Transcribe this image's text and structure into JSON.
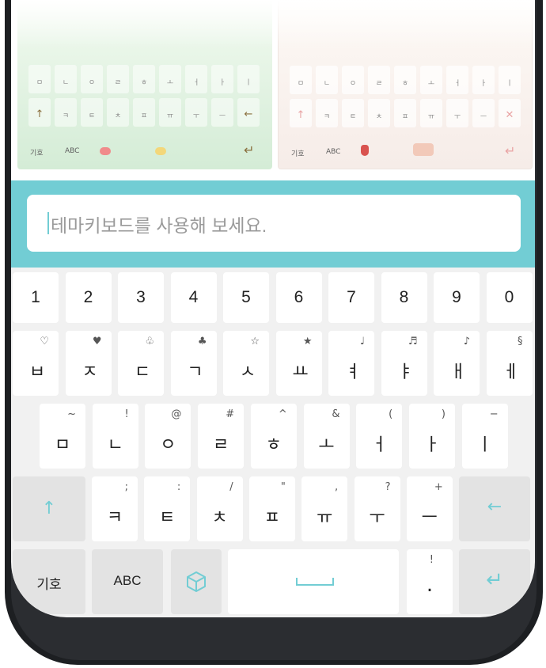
{
  "themes": [
    {
      "name": "mint",
      "rows": [
        [
          "ㅁ",
          "ㄴ",
          "ㅇ",
          "ㄹ",
          "ㅎ",
          "ㅗ",
          "ㅓ",
          "ㅏ",
          "ㅣ"
        ],
        [
          "↑",
          "ㅋ",
          "ㅌ",
          "ㅊ",
          "ㅍ",
          "ㅠ",
          "ㅜ",
          "ㅡ",
          "←"
        ]
      ],
      "bottom": {
        "symbols": "기호",
        "abc": "ABC",
        "enter": "↵"
      },
      "colors": {
        "accent": "#8a6f3e",
        "macaron1": "#f08b8b",
        "macaron2": "#f3d77a"
      }
    },
    {
      "name": "pink",
      "rows": [
        [
          "ㅁ",
          "ㄴ",
          "ㅇ",
          "ㄹ",
          "ㅎ",
          "ㅗ",
          "ㅓ",
          "ㅏ",
          "ㅣ"
        ],
        [
          "↑",
          "ㅋ",
          "ㅌ",
          "ㅊ",
          "ㅍ",
          "ㅠ",
          "ㅜ",
          "ㅡ",
          "✕"
        ]
      ],
      "bottom": {
        "symbols": "기호",
        "abc": "ABC",
        "enter": "↵"
      },
      "colors": {
        "accent": "#e9a3a3"
      }
    }
  ],
  "input": {
    "placeholder": "테마키보드를 사용해 보세요."
  },
  "keyboard": {
    "number_row": [
      "1",
      "2",
      "3",
      "4",
      "5",
      "6",
      "7",
      "8",
      "9",
      "0"
    ],
    "row1": [
      {
        "main": "ㅂ",
        "sub": "♡"
      },
      {
        "main": "ㅈ",
        "sub": "♥"
      },
      {
        "main": "ㄷ",
        "sub": "♧"
      },
      {
        "main": "ㄱ",
        "sub": "♣"
      },
      {
        "main": "ㅅ",
        "sub": "☆"
      },
      {
        "main": "ㅛ",
        "sub": "★"
      },
      {
        "main": "ㅕ",
        "sub": "♩"
      },
      {
        "main": "ㅑ",
        "sub": "♬"
      },
      {
        "main": "ㅐ",
        "sub": "♪"
      },
      {
        "main": "ㅔ",
        "sub": "§"
      }
    ],
    "row2": [
      {
        "main": "ㅁ",
        "sub": "~"
      },
      {
        "main": "ㄴ",
        "sub": "!"
      },
      {
        "main": "ㅇ",
        "sub": "@"
      },
      {
        "main": "ㄹ",
        "sub": "#"
      },
      {
        "main": "ㅎ",
        "sub": "^"
      },
      {
        "main": "ㅗ",
        "sub": "&"
      },
      {
        "main": "ㅓ",
        "sub": "("
      },
      {
        "main": "ㅏ",
        "sub": ")"
      },
      {
        "main": "ㅣ",
        "sub": "−"
      }
    ],
    "row3": [
      {
        "main": "ㅋ",
        "sub": ";"
      },
      {
        "main": "ㅌ",
        "sub": ":"
      },
      {
        "main": "ㅊ",
        "sub": "/"
      },
      {
        "main": "ㅍ",
        "sub": "\""
      },
      {
        "main": "ㅠ",
        "sub": ","
      },
      {
        "main": "ㅜ",
        "sub": "?"
      },
      {
        "main": "ㅡ",
        "sub": "+"
      }
    ],
    "shift_icon": "↑",
    "backspace_icon": "←",
    "bottom": {
      "symbols_label": "기호",
      "abc_label": "ABC",
      "emoji_icon": "cube-icon",
      "period_main": ".",
      "period_sub": "!",
      "enter_icon": "↵"
    },
    "colors": {
      "accent": "#72cdd4",
      "key_bg": "#ffffff",
      "func_bg": "#e3e3e3",
      "board_bg": "#f1f1f1"
    }
  }
}
